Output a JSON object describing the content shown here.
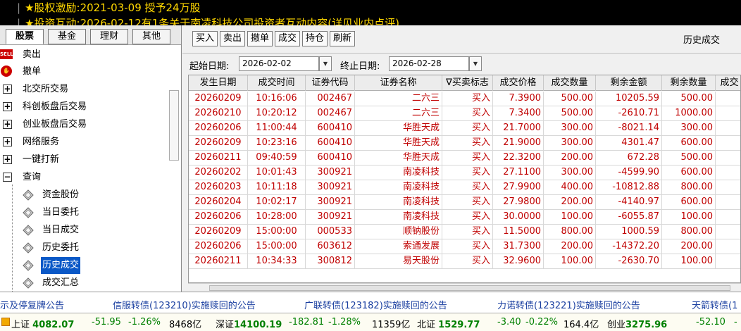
{
  "news": {
    "line1": "★股权激励:2021-03-09 授予24万股",
    "line2": "★投资互动:2026-02-12有1条关于南凌科技公司投资者互动内容(详见业内点评)"
  },
  "left": {
    "tabs": [
      "股票",
      "基金",
      "理财",
      "其他"
    ],
    "sell_icon_text": "SELL",
    "items": [
      {
        "label": "卖出",
        "icon": "sell-icon"
      },
      {
        "label": "撤单",
        "icon": "cancel-icon"
      },
      {
        "label": "北交所交易",
        "icon": "expand-plus-icon"
      },
      {
        "label": "科创板盘后交易",
        "icon": "expand-plus-icon"
      },
      {
        "label": "创业板盘后交易",
        "icon": "expand-plus-icon"
      },
      {
        "label": "网络服务",
        "icon": "expand-plus-icon"
      },
      {
        "label": "一键打新",
        "icon": "expand-plus-icon"
      },
      {
        "label": "查询",
        "icon": "collapse-minus-icon"
      }
    ],
    "sub_items": [
      "资金股份",
      "当日委托",
      "当日成交",
      "历史委托",
      "历史成交",
      "成交汇总"
    ],
    "selected_sub": "历史成交"
  },
  "toolbar": {
    "buttons": [
      "买入",
      "卖出",
      "撤单",
      "成交",
      "持仓",
      "刷新"
    ],
    "title": "历史成交"
  },
  "filter": {
    "start_label": "起始日期:",
    "start_value": "2026-02-02",
    "end_label": "终止日期:",
    "end_value": "2026-02-28"
  },
  "table": {
    "columns": [
      "发生日期",
      "成交时间",
      "证券代码",
      "证券名称",
      "∇买卖标志",
      "成交价格",
      "成交数量",
      "剩余金额",
      "剩余数量",
      "成交"
    ],
    "rows": [
      [
        "20260209",
        "10:16:06",
        "002467",
        "二六三",
        "买入",
        "7.3900",
        "500.00",
        "10205.59",
        "500.00"
      ],
      [
        "20260210",
        "10:20:12",
        "002467",
        "二六三",
        "买入",
        "7.3400",
        "500.00",
        "-2610.71",
        "1000.00"
      ],
      [
        "20260206",
        "11:00:44",
        "600410",
        "华胜天成",
        "买入",
        "21.7000",
        "300.00",
        "-8021.14",
        "300.00"
      ],
      [
        "20260209",
        "10:23:16",
        "600410",
        "华胜天成",
        "买入",
        "21.9000",
        "300.00",
        "4301.47",
        "600.00"
      ],
      [
        "20260211",
        "09:40:59",
        "600410",
        "华胜天成",
        "买入",
        "22.3200",
        "200.00",
        "672.28",
        "500.00"
      ],
      [
        "20260202",
        "10:01:43",
        "300921",
        "南凌科技",
        "买入",
        "27.1100",
        "300.00",
        "-4599.90",
        "600.00"
      ],
      [
        "20260203",
        "10:11:18",
        "300921",
        "南凌科技",
        "买入",
        "27.9900",
        "400.00",
        "-10812.88",
        "800.00"
      ],
      [
        "20260204",
        "10:02:17",
        "300921",
        "南凌科技",
        "买入",
        "27.9800",
        "200.00",
        "-4140.97",
        "600.00"
      ],
      [
        "20260206",
        "10:28:00",
        "300921",
        "南凌科技",
        "买入",
        "30.0000",
        "100.00",
        "-6055.87",
        "100.00"
      ],
      [
        "20260209",
        "15:00:00",
        "000533",
        "顺钠股份",
        "买入",
        "11.5000",
        "800.00",
        "1000.59",
        "800.00"
      ],
      [
        "20260206",
        "15:00:00",
        "603612",
        "索通发展",
        "买入",
        "31.7300",
        "200.00",
        "-14372.20",
        "200.00"
      ],
      [
        "20260211",
        "10:34:33",
        "300812",
        "易天股份",
        "买入",
        "32.9600",
        "100.00",
        "-2630.70",
        "100.00"
      ]
    ]
  },
  "notices": [
    "示及停复牌公告",
    "信服转债(123210)实施赎回的公告",
    "广联转债(123182)实施赎回的公告",
    "力诺转债(123221)实施赎回的公告",
    "天箭转债(1"
  ],
  "indices": {
    "sh_name": "上证",
    "sh_value": "4082.07",
    "sh_change": "-51.95",
    "sh_pct": "-1.26%",
    "sh_vol": "8468亿",
    "sz_name": "深证",
    "sz_value": "14100.19",
    "sz_change": "-182.81",
    "sz_pct": "-1.28%",
    "sz_vol": "11359亿",
    "bz_name": "北证",
    "bz_value": "1529.77",
    "bz_change": "-3.40",
    "bz_pct": "-0.22%",
    "bz_vol": "164.4亿",
    "cy_name": "创业",
    "cy_value": "3275.96",
    "cy_change": "-52.10",
    "cy_pct": "-"
  },
  "colors": {
    "price_red": "#c00000",
    "down_green": "#008000",
    "selection_blue": "#0a58c7",
    "news_yellow": "#ffd700"
  }
}
